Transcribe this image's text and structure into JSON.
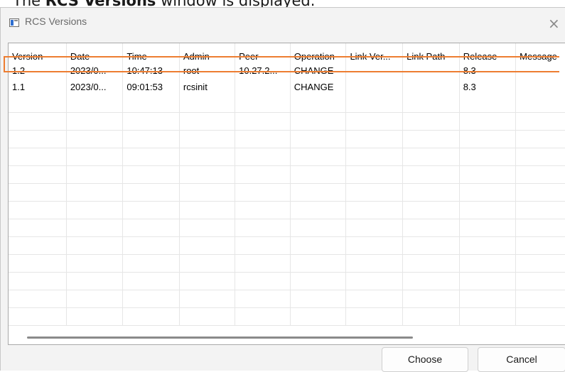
{
  "caption": {
    "prefix": "The ",
    "bold": "RCS Versions",
    "suffix": " window is displayed."
  },
  "window": {
    "title": "RCS Versions",
    "close_glyph": "×"
  },
  "table": {
    "columns": [
      "Version",
      "Date",
      "Time",
      "Admin",
      "Peer",
      "Operation",
      "Link Ver...",
      "Link Path",
      "Release",
      "Message"
    ],
    "rows": [
      [
        "1.2",
        "2023/0...",
        "10:47:13",
        "root",
        "10.27.2...",
        "CHANGE",
        "",
        "",
        "8.3",
        ""
      ],
      [
        "1.1",
        "2023/0...",
        "09:01:53",
        "rcsinit",
        "",
        "CHANGE",
        "",
        "",
        "8.3",
        ""
      ]
    ],
    "highlighted_row": 1,
    "highlight_color": "#ed7d31"
  },
  "buttons": {
    "choose": "Choose",
    "cancel": "Cancel"
  }
}
